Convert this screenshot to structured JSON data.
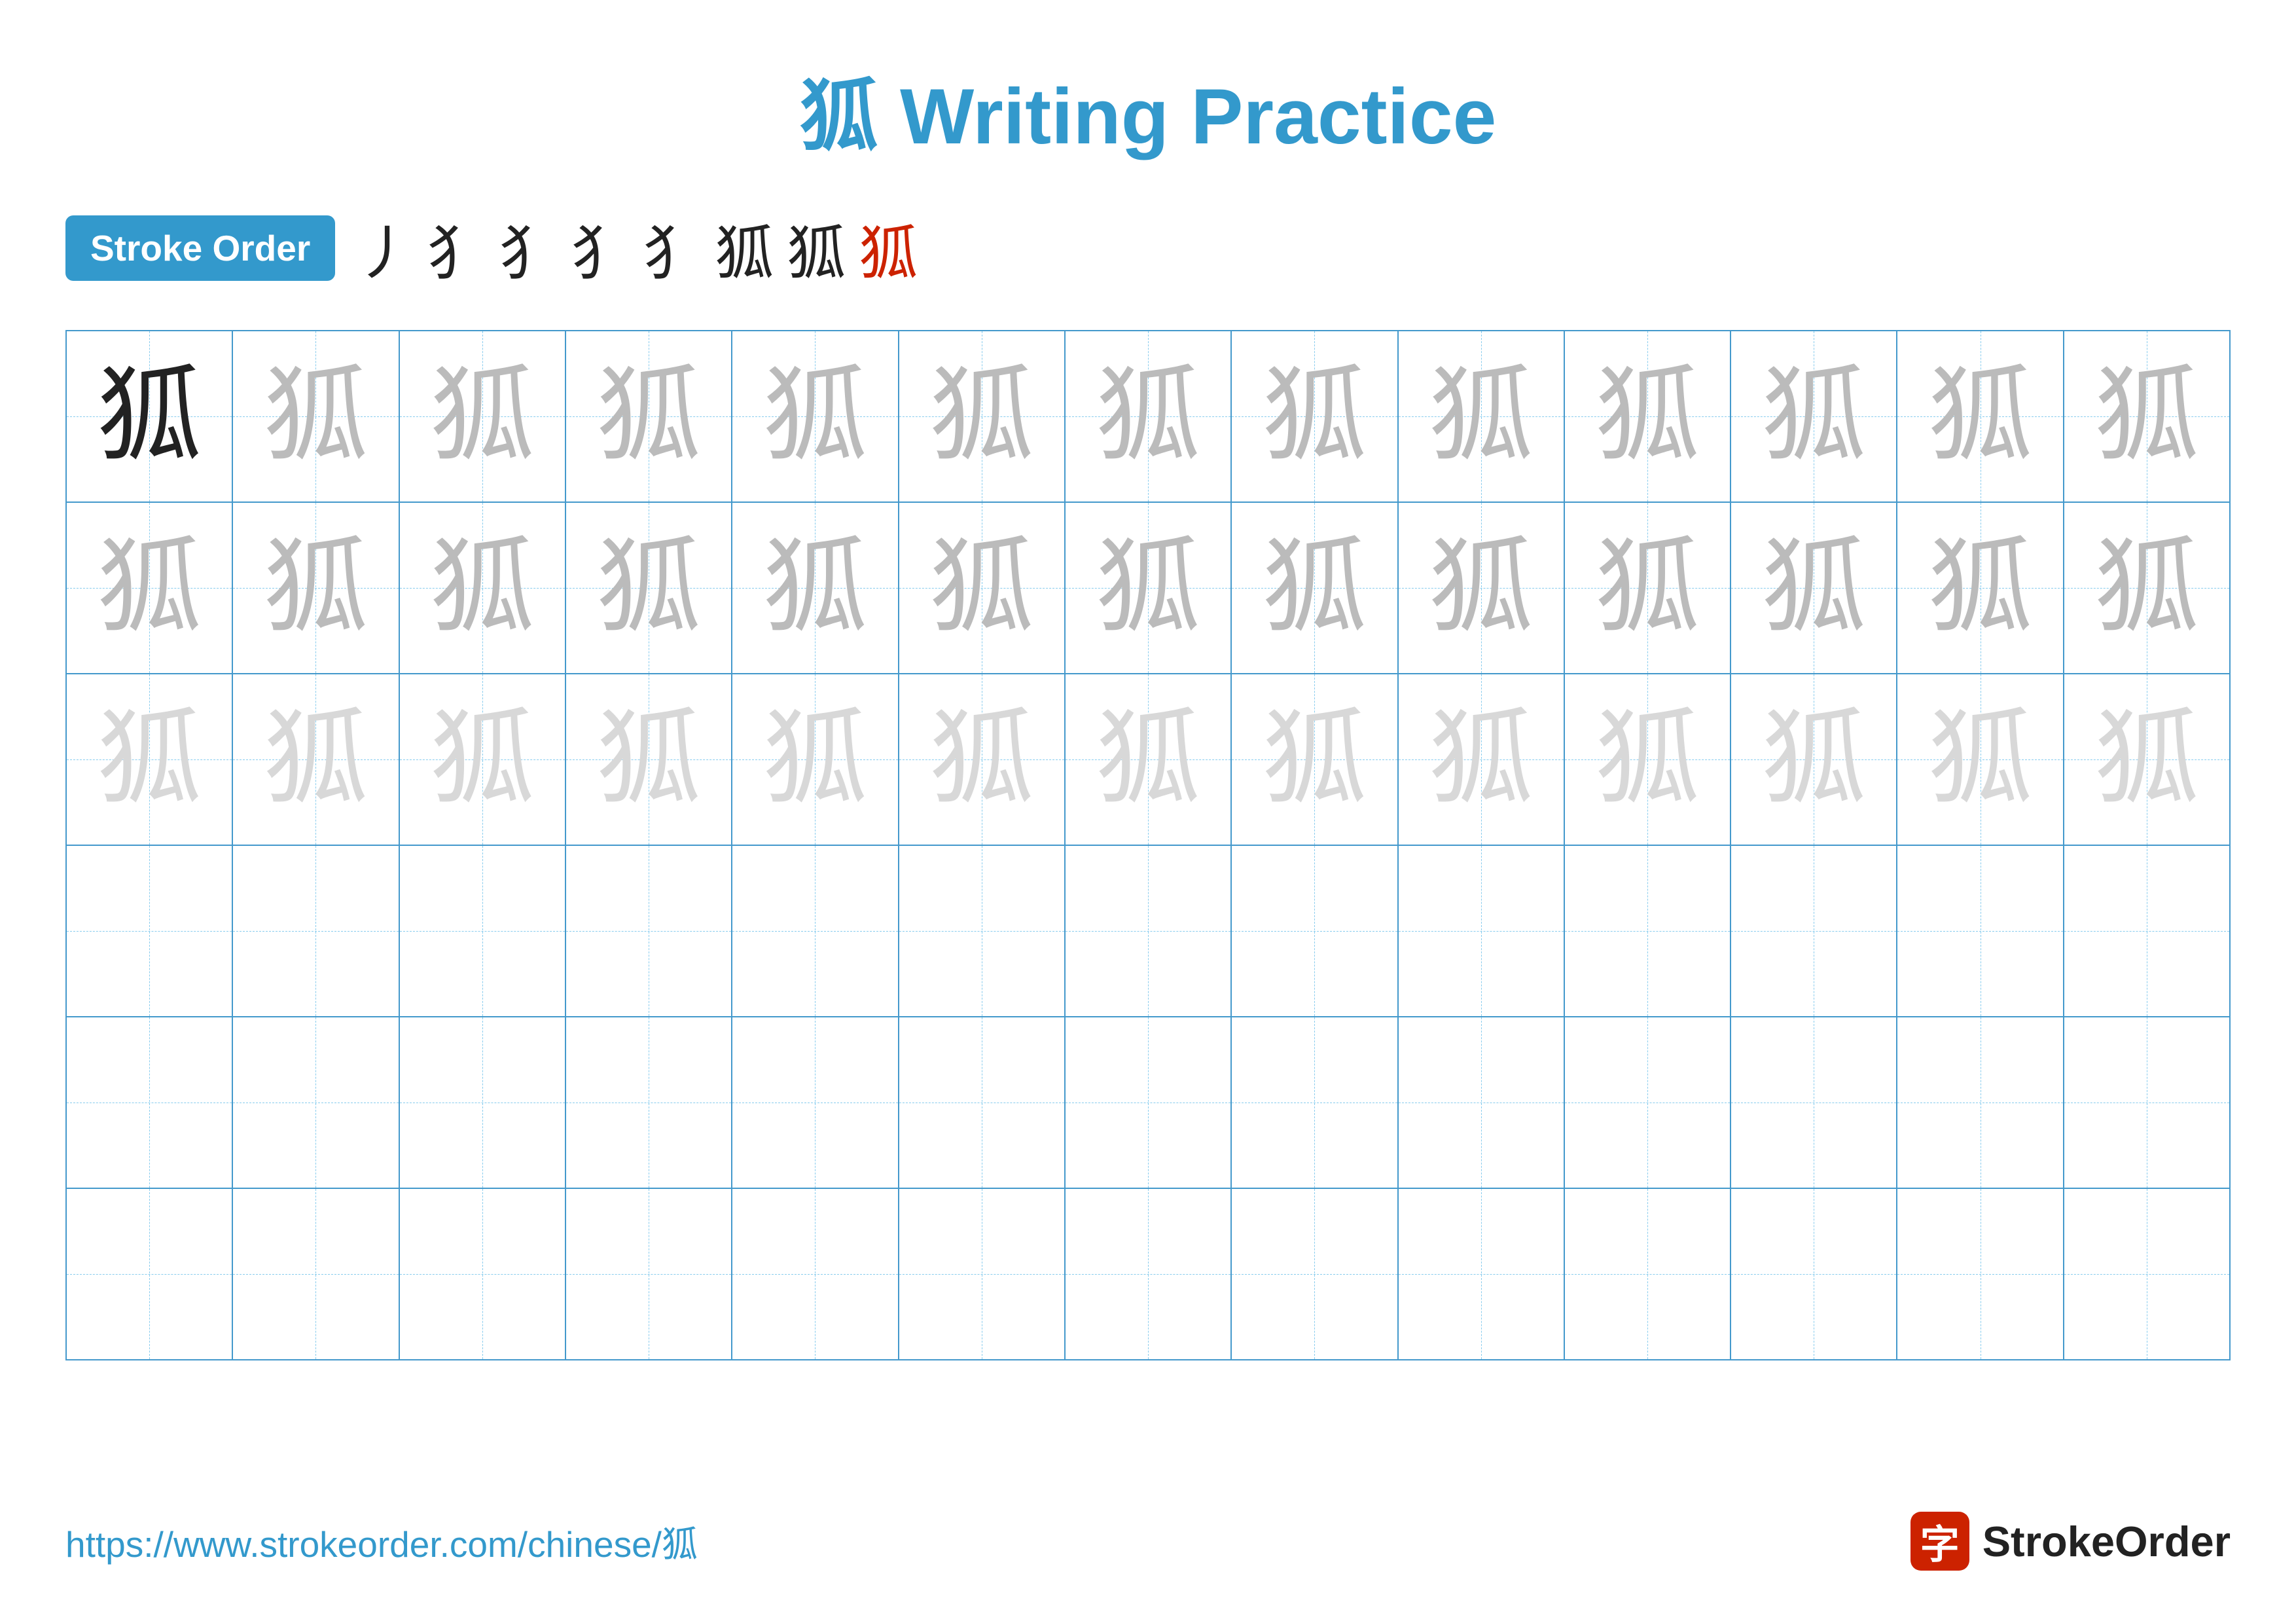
{
  "title": {
    "chinese_char": "狐",
    "rest": " Writing Practice"
  },
  "stroke_order": {
    "badge_label": "Stroke Order",
    "strokes": [
      "丶",
      "犭",
      "犭",
      "犭’",
      "犭’’",
      "狐―",
      "狐",
      "狐"
    ]
  },
  "grid": {
    "rows": 6,
    "cols": 13,
    "character": "狐",
    "row_styles": [
      "dark+medium",
      "medium",
      "light",
      "empty",
      "empty",
      "empty"
    ]
  },
  "footer": {
    "url": "https://www.strokeorder.com/chinese/狐",
    "logo_icon": "字",
    "logo_name": "StrokeOrder"
  }
}
